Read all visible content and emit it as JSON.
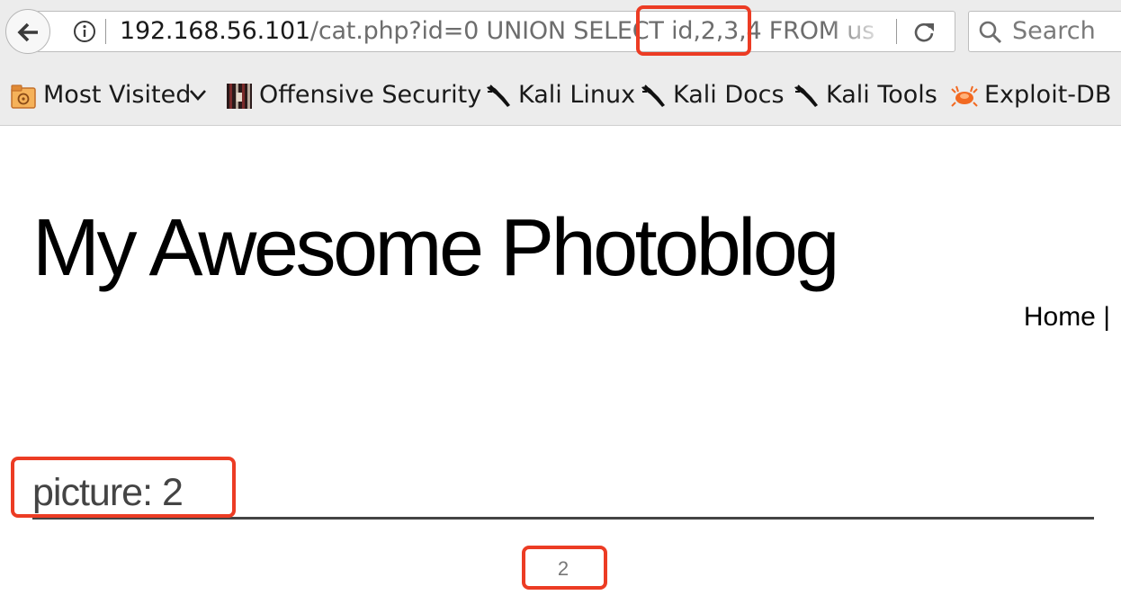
{
  "browser": {
    "url_host": "192.168.56.101",
    "url_path": "/cat.php?id=0 UNION SELECT id,2,3,4 FROM us",
    "search_placeholder": "Search",
    "bookmarks": [
      {
        "label": "Most Visited",
        "icon": "most-visited-icon",
        "has_dropdown": true
      },
      {
        "label": "Offensive Security",
        "icon": "offensive-security-icon"
      },
      {
        "label": "Kali Linux",
        "icon": "kali-dragon-icon"
      },
      {
        "label": "Kali Docs",
        "icon": "kali-dragon-icon"
      },
      {
        "label": "Kali Tools",
        "icon": "kali-dragon-icon"
      },
      {
        "label": "Exploit-DB",
        "icon": "exploit-db-icon"
      }
    ]
  },
  "page": {
    "title": "My Awesome Photoblog",
    "nav": "Home |",
    "picture_heading": "picture: 2",
    "picture_value": "2"
  },
  "annotations": {
    "highlight_color": "#ec3c24",
    "highlighted": [
      "url-columns-highlight",
      "picture-heading-highlight",
      "picture-value-highlight"
    ]
  },
  "colors": {
    "chrome_background": "#ececec",
    "heading_text": "#444444",
    "muted_text": "#777777"
  }
}
